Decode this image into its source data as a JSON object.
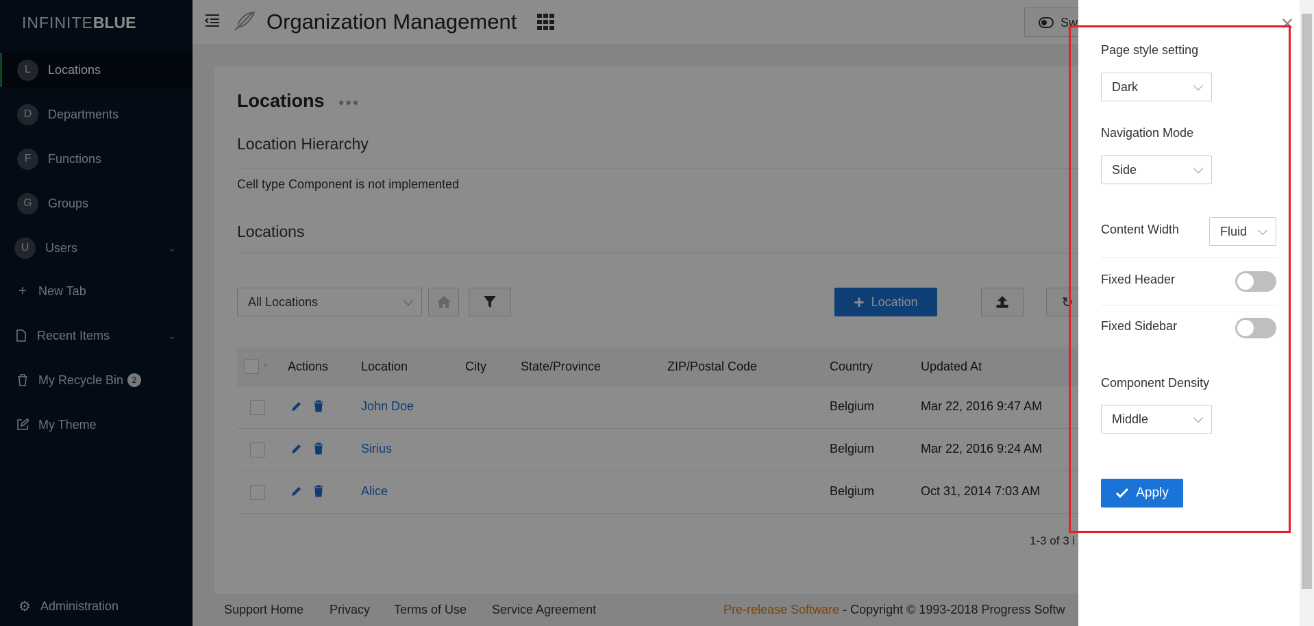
{
  "app": {
    "logo_thin": "INFINITE",
    "logo_bold": "BLUE"
  },
  "sidebar": {
    "items": [
      {
        "avatar": "L",
        "label": "Locations"
      },
      {
        "avatar": "D",
        "label": "Departments"
      },
      {
        "avatar": "F",
        "label": "Functions"
      },
      {
        "avatar": "G",
        "label": "Groups"
      },
      {
        "avatar": "U",
        "label": "Users"
      },
      {
        "icon": "plus-icon",
        "label": "New Tab"
      },
      {
        "icon": "file-icon",
        "label": "Recent Items"
      },
      {
        "icon": "trash-icon",
        "label": "My Recycle Bin",
        "badge": "2"
      },
      {
        "icon": "edit-icon",
        "label": "My Theme"
      }
    ],
    "admin_label": "Administration"
  },
  "header": {
    "title": "Organization Management",
    "switch_label": "Sw"
  },
  "main": {
    "page_heading": "Locations",
    "hierarchy_title": "Location Hierarchy",
    "cell_message": "Cell type Component is not implemented",
    "locations_title": "Locations",
    "filter_select": "All Locations",
    "add_button": "Location",
    "table": {
      "headers": [
        "Actions",
        "Location",
        "City",
        "State/Province",
        "ZIP/Postal Code",
        "Country",
        "Updated At"
      ],
      "rows": [
        {
          "location": "John Doe",
          "country": "Belgium",
          "updated": "Mar 22, 2016 9:47 AM"
        },
        {
          "location": "Sirius",
          "country": "Belgium",
          "updated": "Mar 22, 2016 9:24 AM"
        },
        {
          "location": "Alice",
          "country": "Belgium",
          "updated": "Oct 31, 2014 7:03 AM"
        }
      ]
    },
    "pager": "1-3 of 3 i"
  },
  "footer": {
    "links": [
      "Support Home",
      "Privacy",
      "Terms of Use",
      "Service Agreement"
    ],
    "prerelease": "Pre-release Software",
    "copyright": " - Copyright © 1993-2018 Progress Softw"
  },
  "drawer": {
    "page_style_label": "Page style setting",
    "page_style_value": "Dark",
    "nav_mode_label": "Navigation Mode",
    "nav_mode_value": "Side",
    "content_width_label": "Content Width",
    "content_width_value": "Fluid",
    "fixed_header_label": "Fixed Header",
    "fixed_header_on": false,
    "fixed_sidebar_label": "Fixed Sidebar",
    "fixed_sidebar_on": false,
    "density_label": "Component Density",
    "density_value": "Middle",
    "apply_label": "Apply"
  },
  "colors": {
    "accent": "#1a73d6",
    "sidebar_bg": "#071426",
    "highlight": "#e0202a",
    "prerelease": "#e07a12"
  }
}
